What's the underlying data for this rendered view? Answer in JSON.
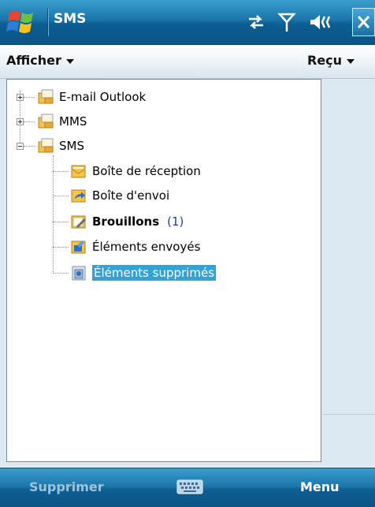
{
  "titlebar": {
    "app_title": "SMS",
    "icons": [
      "windows-start-icon",
      "connectivity-icon",
      "signal-icon",
      "volume-icon",
      "close-icon"
    ]
  },
  "menubar": {
    "left_label": "Afficher",
    "right_label": "Reçu"
  },
  "tree": [
    {
      "label": "E-mail Outlook",
      "expanded": false,
      "level": 0,
      "icon": "account-folder-icon"
    },
    {
      "label": "MMS",
      "expanded": false,
      "level": 0,
      "icon": "account-folder-icon"
    },
    {
      "label": "SMS",
      "expanded": true,
      "level": 0,
      "icon": "account-folder-icon"
    },
    {
      "label": "Boîte de réception",
      "level": 1,
      "icon": "inbox-icon"
    },
    {
      "label": "Boîte d'envoi",
      "level": 1,
      "icon": "outbox-icon"
    },
    {
      "label": "Brouillons",
      "level": 1,
      "count": "(1)",
      "bold": true,
      "icon": "drafts-icon"
    },
    {
      "label": "Éléments envoyés",
      "level": 1,
      "icon": "sent-items-icon"
    },
    {
      "label": "Éléments supprimés",
      "level": 1,
      "selected": true,
      "icon": "deleted-items-icon"
    }
  ],
  "softkeys": {
    "left": "Supprimer",
    "right": "Menu"
  },
  "colors": {
    "bar_blue": "#1a74a8",
    "selection": "#33a2d6",
    "count_blue": "#1c3fa6",
    "disabled_softkey": "#9dc4dc"
  }
}
